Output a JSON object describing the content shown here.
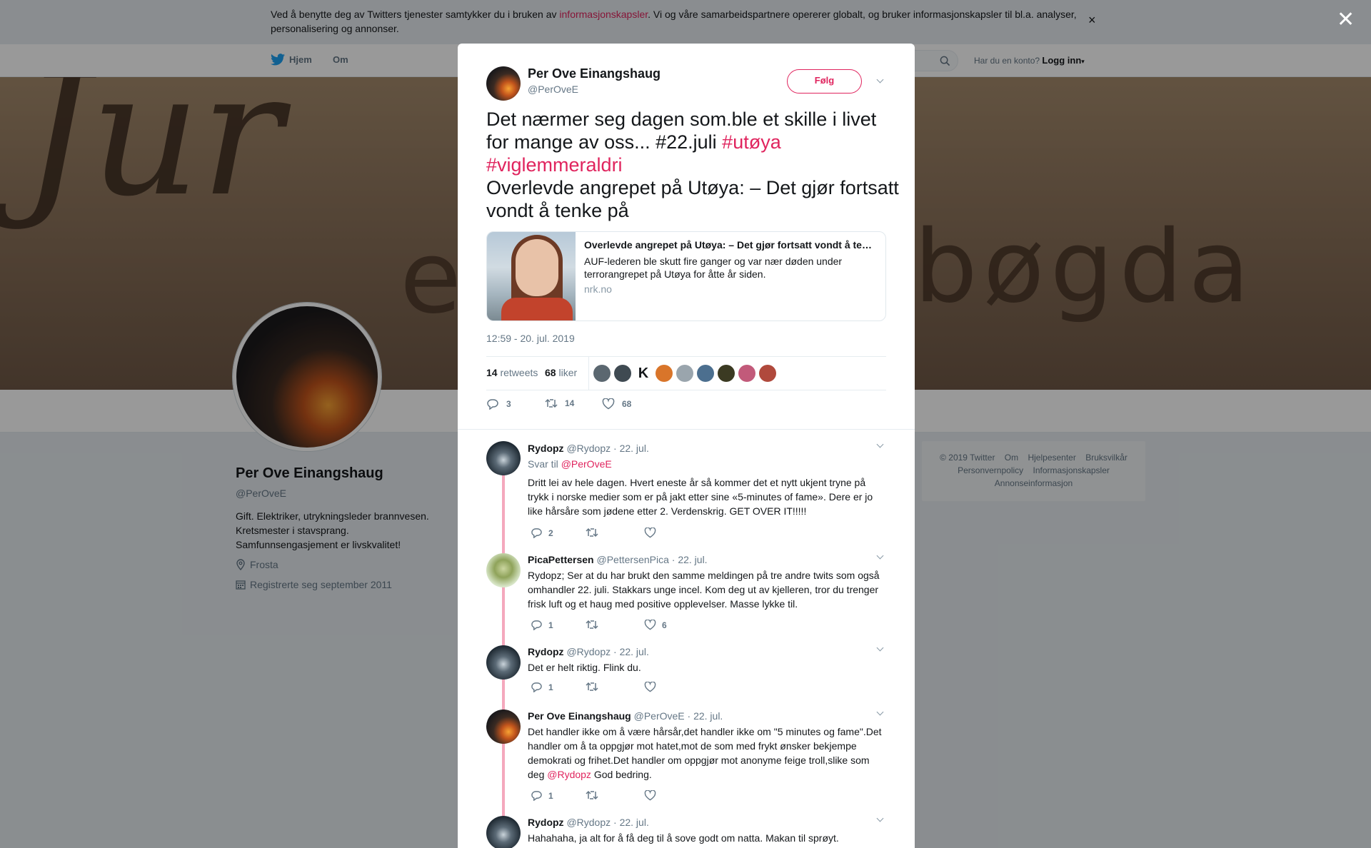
{
  "cookie": {
    "text_before": "Ved å benytte deg av Twitters tjenester samtykker du i bruken av ",
    "link": "informasjonskapsler",
    "text_after": ". Vi og våre samarbeidspartnere opererer globalt, og bruker informasjonskapsler til bl.a. analyser, personalisering og annonser.",
    "close": "×"
  },
  "nav": {
    "home": "Hjem",
    "about": "Om",
    "login_prompt": "Har du en konto?",
    "login": "Logg inn"
  },
  "banner": {
    "script": "Jur",
    "e": "e",
    "text": "bøgda"
  },
  "profile": {
    "name": "Per Ove Einangshaug",
    "handle": "@PerOveE",
    "bio_lines": [
      "Gift. Elektriker, utrykningsleder brannvesen.",
      "Kretsmester i stavsprang.",
      "Samfunnsengasjement er livskvalitet!"
    ],
    "location": "Frosta",
    "joined": "Registrerte seg september 2011"
  },
  "footer": {
    "items": [
      "© 2019 Twitter",
      "Om",
      "Hjelpesenter",
      "Bruksvilkår",
      "Personvernpolicy",
      "Informasjonskapsler",
      "Annonseinformasjon"
    ]
  },
  "overlay": {
    "close": "✕"
  },
  "tweet": {
    "author_name": "Per Ove Einangshaug",
    "author_handle": "@PerOveE",
    "follow": "Følg",
    "text_part1": "Det nærmer seg dagen som.ble et skille i livet for mange av oss... #22.juli ",
    "hashtag1": "#utøya",
    "hashtag2": "#viglemmeraldri",
    "text_part2": "Overlevde angrepet på Utøya: – Det gjør fortsatt vondt å tenke på",
    "card": {
      "title": "Overlevde angrepet på Utøya: – Det gjør fortsatt vondt å tenke på",
      "description": "AUF-lederen ble skutt fire ganger og var nær døden under terrorangrepet på Utøya for åtte år siden.",
      "domain": "nrk.no"
    },
    "timestamp": "12:59 - 20. jul. 2019",
    "retweets_count": "14",
    "retweets_label": "retweets",
    "likes_count": "68",
    "likes_label": "liker",
    "liker_letter": "K",
    "liker_colors": [
      "#5b6770",
      "#3f4a52",
      "#ffffff",
      "#d9752a",
      "#9aa5ad",
      "#4c6f8f",
      "#3b3a22",
      "#c25a7a",
      "#b0493c"
    ],
    "actions": {
      "replies": "3",
      "retweets": "14",
      "likes": "68"
    }
  },
  "replies": [
    {
      "name": "Rydopz",
      "handle": "@Rydopz",
      "date": "· 22. jul.",
      "reply_to_label": "Svar til",
      "reply_to": "@PerOveE",
      "lines": [
        "Dritt lei av hele dagen. Hvert eneste år så kommer det et nytt ukjent tryne på",
        "trykk i norske medier som er på jakt etter sine «5-minutes of fame». Dere er jo",
        "like hårsåre som jødene etter 2. Verdenskrig. GET OVER IT!!!!!"
      ],
      "replies": "2",
      "retweets": "",
      "likes": ""
    },
    {
      "name": "PicaPettersen",
      "handle": "@PettersenPica",
      "date": "· 22. jul.",
      "lines": [
        "Rydopz; Ser at du har brukt den samme meldingen på tre andre twits som også",
        "omhandler 22. juli. Stakkars unge incel. Kom deg ut av kjelleren, tror du trenger",
        "frisk luft og et haug med positive opplevelser. Masse lykke til."
      ],
      "replies": "1",
      "retweets": "",
      "likes": "6"
    },
    {
      "name": "Rydopz",
      "handle": "@Rydopz",
      "date": "· 22. jul.",
      "lines": [
        "Det er helt riktig. Flink du."
      ],
      "replies": "1",
      "retweets": "",
      "likes": ""
    },
    {
      "name": "Per Ove Einangshaug",
      "handle": "@PerOveE",
      "date": "· 22. jul.",
      "lines": [
        "Det handler ikke om å være hårsår,det handler ikke om \"5 minutes og fame\".Det",
        "handler om å ta oppgjør mot hatet,mot de som med frykt ønsker bekjempe",
        "demokrati og frihet.Det handler om oppgjør mot anonyme feige troll,slike som"
      ],
      "last_line_prefix": "deg ",
      "last_line_mention": "@Rydopz",
      "last_line_suffix": " God bedring.",
      "replies": "1",
      "retweets": "",
      "likes": ""
    },
    {
      "name": "Rydopz",
      "handle": "@Rydopz",
      "date": "· 22. jul.",
      "lines": [
        "Hahahaha, ja alt for å få deg til å sove godt om natta. Makan til sprøyt."
      ]
    }
  ]
}
